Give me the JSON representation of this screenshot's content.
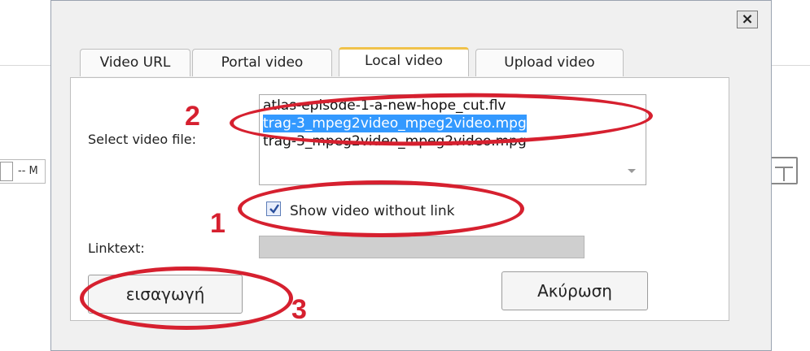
{
  "dialog": {
    "close_label": "×",
    "tabs": [
      {
        "label": "Video URL",
        "active": false
      },
      {
        "label": "Portal video",
        "active": false
      },
      {
        "label": "Local video",
        "active": true
      },
      {
        "label": "Upload video",
        "active": false
      }
    ],
    "select_video_label": "Select video file:",
    "files": [
      {
        "name": "atlas-episode-1-a-new-hope_cut.flv",
        "selected": false
      },
      {
        "name": "trag-3_mpeg2video_mpeg2video.mpg",
        "selected": true
      },
      {
        "name": "trag-3_mpeg2video_mpeg2video.mpg",
        "selected": false
      }
    ],
    "show_without_link": {
      "label": "Show video without link",
      "checked": true
    },
    "linktext_label": "Linktext:",
    "linktext_value": "",
    "insert_button": "εισαγωγή",
    "cancel_button": "Ακύρωση"
  },
  "background": {
    "field_text": "-- M"
  },
  "annotations": {
    "step1": "1",
    "step2": "2",
    "step3": "3",
    "color": "#d6202f"
  },
  "colors": {
    "selection": "#3399ff",
    "active_tab_accent": "#f0c24a"
  }
}
